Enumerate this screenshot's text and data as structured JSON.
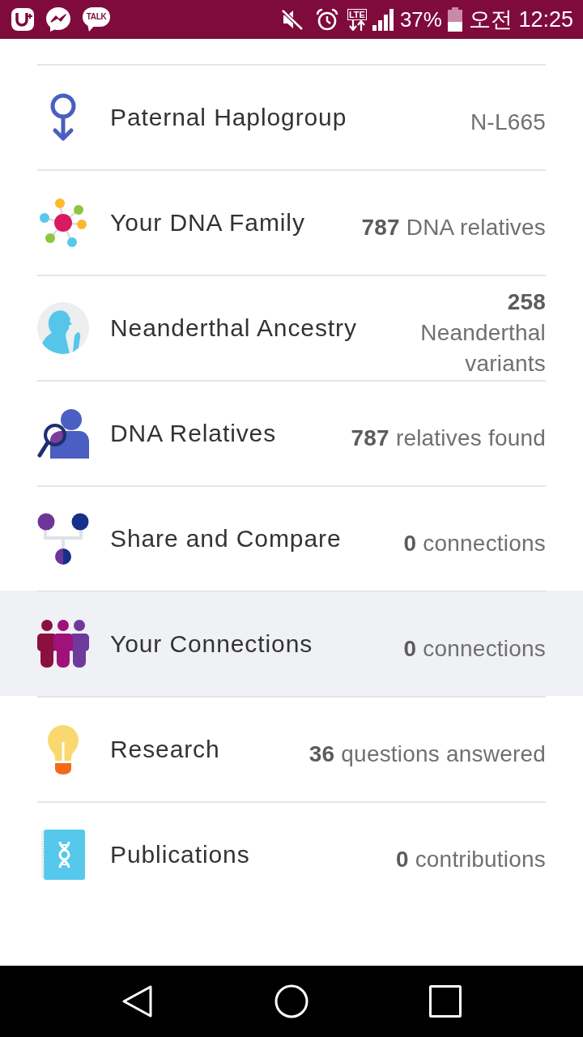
{
  "status_bar": {
    "chat_badge": "TALK",
    "network": "LTE",
    "battery": "37%",
    "time": "오전 12:25"
  },
  "features": [
    {
      "kind": "haplogroup",
      "title": "Paternal Haplogroup",
      "value": "N-L665",
      "selected": false
    },
    {
      "kind": "family",
      "title": "Your DNA Family",
      "value": "**787** DNA relatives",
      "selected": false
    },
    {
      "kind": "neanderthal",
      "title": "Neanderthal Ancestry",
      "value": "**258** Neanderthal variants",
      "selected": false
    },
    {
      "kind": "relatives",
      "title": "DNA Relatives",
      "value": "**787** relatives found",
      "selected": false
    },
    {
      "kind": "compare",
      "title": "Share and Compare",
      "value": "**0** connections",
      "selected": false
    },
    {
      "kind": "connections",
      "title": "Your Connections",
      "value": "**0** connections",
      "selected": true
    },
    {
      "kind": "research",
      "title": "Research",
      "value": "**36** questions answered",
      "selected": false
    },
    {
      "kind": "publications",
      "title": "Publications",
      "value": "**0** contributions",
      "selected": false
    }
  ]
}
